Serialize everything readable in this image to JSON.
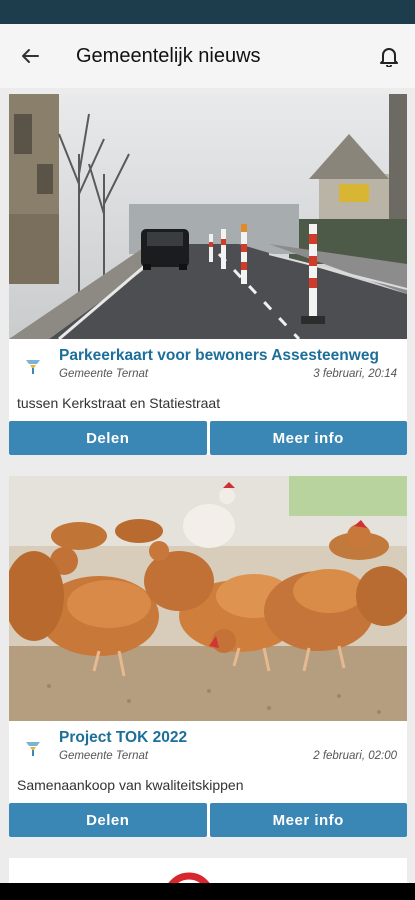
{
  "appbar": {
    "title": "Gemeentelijk nieuws",
    "back_icon": "arrow-left-icon",
    "bell_icon": "bell-icon"
  },
  "news": [
    {
      "title": "Parkeerkaart voor bewoners Assesteenweg",
      "organization": "Gemeente Ternat",
      "date": "3 februari, 20:14",
      "description": "tussen Kerkstraat en Statiestraat",
      "share_label": "Delen",
      "more_label": "Meer info",
      "image": "street-photo"
    },
    {
      "title": "Project TOK 2022",
      "organization": "Gemeente Ternat",
      "date": "2 februari, 02:00",
      "description": "Samenaankoop van kwaliteitskippen",
      "share_label": "Delen",
      "more_label": "Meer info",
      "image": "chickens-photo"
    }
  ],
  "colors": {
    "accent": "#3a87b5",
    "title": "#1d6f9a",
    "statusbar": "#1d3c4c"
  }
}
